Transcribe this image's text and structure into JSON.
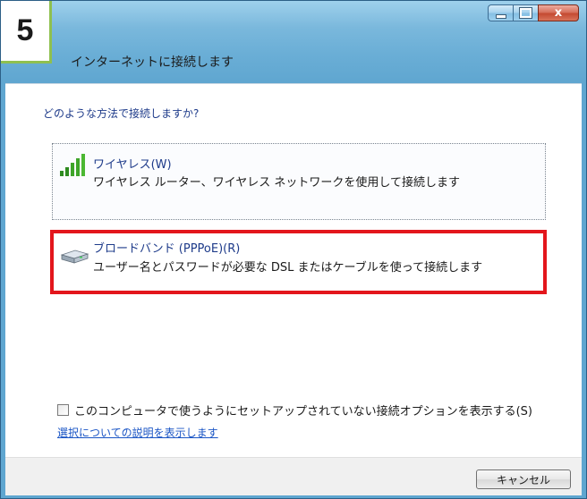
{
  "step_badge": "5",
  "window": {
    "title": "インターネットに接続します",
    "controls": {
      "close_glyph": "x"
    }
  },
  "main": {
    "question": "どのような方法で接続しますか?",
    "options": [
      {
        "icon": "wireless-signal-icon",
        "title": "ワイヤレス(W)",
        "description": "ワイヤレス ルーター、ワイヤレス ネットワークを使用して接続します"
      },
      {
        "icon": "broadband-modem-icon",
        "title": "ブロードバンド (PPPoE)(R)",
        "description": "ユーザー名とパスワードが必要な DSL またはケーブルを使って接続します",
        "highlighted": true,
        "highlight_color": "#e3161c"
      }
    ],
    "show_options_checkbox": {
      "label": "このコンピュータで使うようにセットアップされていない接続オプションを表示する(S)",
      "checked": false
    },
    "help_link": "選択についての説明を表示します"
  },
  "footer": {
    "cancel_label": "キャンセル"
  },
  "colors": {
    "badge_border": "#8fc04f",
    "link": "#1a55c5",
    "title_bar": "#7ab8dc"
  }
}
